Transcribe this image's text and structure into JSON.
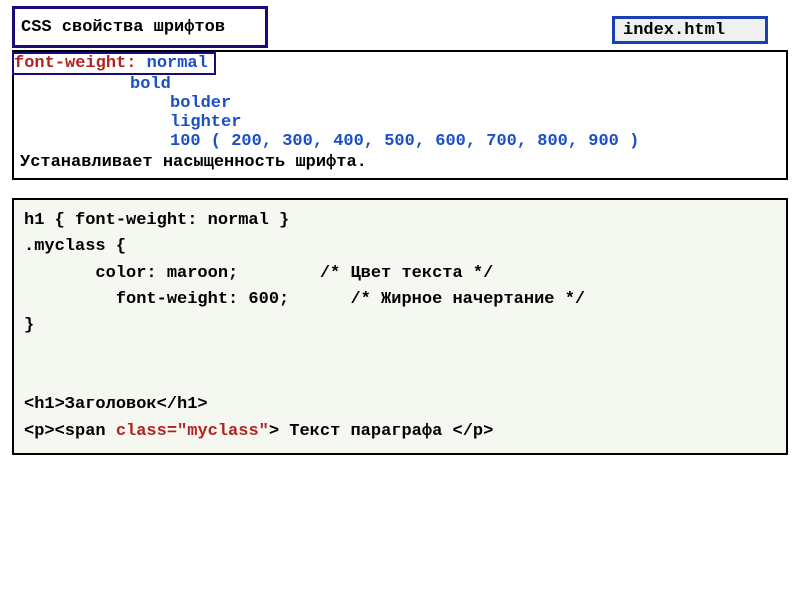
{
  "header": {
    "title": "CSS свойства шрифтов",
    "filename": "index.html"
  },
  "property": {
    "name": "font-weight:",
    "default_value": "normal",
    "values_line1": "bold",
    "values_line2": "bolder",
    "values_line3": "lighter",
    "values_numeric": "100 ( 200, 300, 400, 500, 600, 700, 800, 900 )",
    "description": "Устанавливает насыщенность шрифта."
  },
  "example": {
    "line1": "h1 { font-weight: normal }",
    "line2": ".myclass {",
    "line3": "       color: maroon;        /* Цвет текста */",
    "line4": "         font-weight: 600;      /* Жирное начертание */",
    "line5": "}",
    "blank": "",
    "html1": "<h1>Заголовок</h1>",
    "html2_a": "<p><span ",
    "html2_b": "class=\"myclass\"",
    "html2_c": "> Текст параграфа </p>"
  }
}
